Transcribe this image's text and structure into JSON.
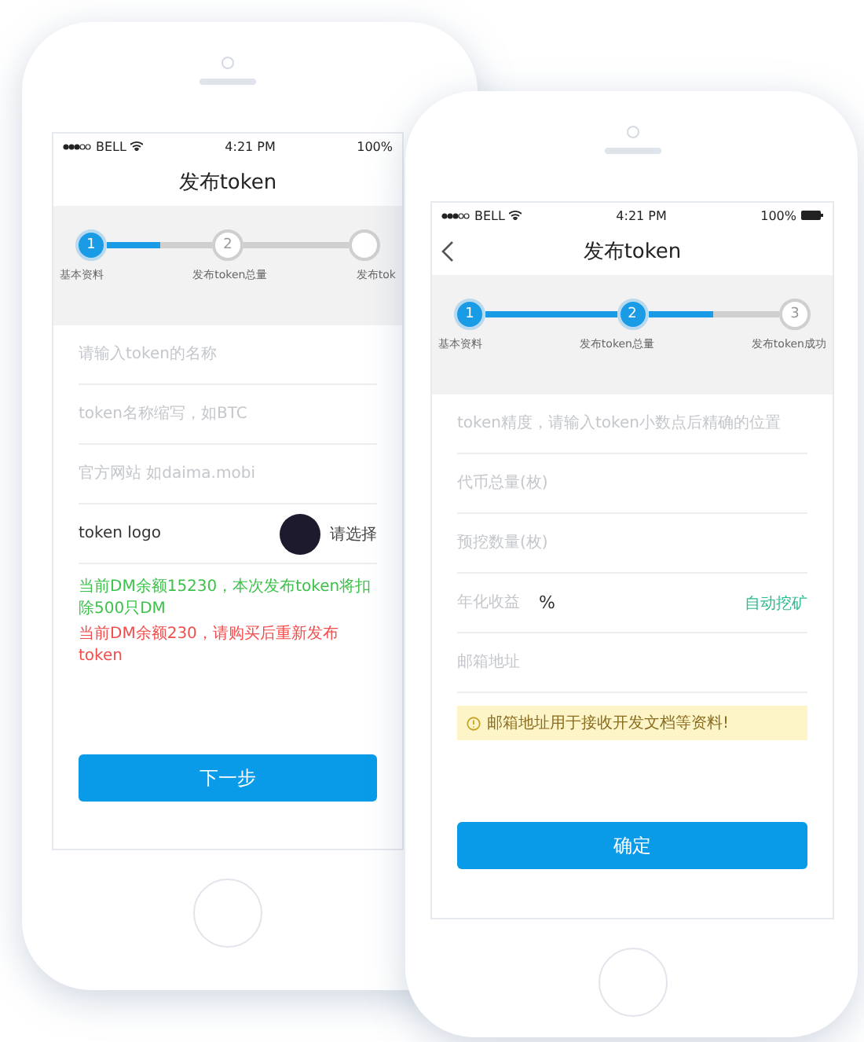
{
  "phones": [
    {
      "status": {
        "carrier": "BELL",
        "time": "4:21 PM",
        "battery": "100%"
      },
      "title": "发布token",
      "back": false,
      "connectors": [
        {
          "level": 0.5
        }
      ],
      "steps": [
        {
          "number": "1",
          "label": "基本资料",
          "done": true
        },
        {
          "number": "2",
          "label": "发布token总量",
          "done": false
        },
        {
          "label": "发布tok",
          "done": false
        }
      ],
      "fields": [
        {
          "kind": "input",
          "placeholder": "请输入token的名称"
        },
        {
          "kind": "input",
          "placeholder": "token名称缩写，如BTC"
        },
        {
          "kind": "input",
          "placeholder": "官方网站 如daima.mobi"
        },
        {
          "kind": "logo",
          "label": "token logo",
          "action": "请选择"
        }
      ],
      "messages": [
        {
          "kind": "message",
          "text": "当前DM余额15230，本次发布token将扣除500只DM",
          "color": "#3cc24a"
        },
        {
          "kind": "message",
          "text": "当前DM余额230，请购买后重新发布token",
          "color": "#f24d4d"
        }
      ],
      "button": "下一步"
    },
    {
      "status": {
        "carrier": "BELL",
        "time": "4:21 PM",
        "battery": "100%"
      },
      "title": "发布token",
      "back": true,
      "connectors": [
        {
          "level": 1
        },
        {
          "level": 0.5
        }
      ],
      "steps": [
        {
          "number": "1",
          "label": "基本资料",
          "done": true
        },
        {
          "number": "2",
          "label": "发布token总量",
          "done": true
        },
        {
          "number": "3",
          "label": "发布token成功",
          "done": false
        }
      ],
      "fields": [
        {
          "kind": "input",
          "placeholder": "token精度，请输入token小数点后精确的位置"
        },
        {
          "kind": "input",
          "placeholder": "代币总量(枚)"
        },
        {
          "kind": "input",
          "placeholder": "预挖数量(枚)"
        },
        {
          "kind": "suffix",
          "placeholder": "年化收益",
          "unit": "%",
          "action": "自动挖矿"
        },
        {
          "kind": "input",
          "placeholder": "邮箱地址"
        }
      ],
      "messages": [
        {
          "kind": "warning",
          "text": "邮箱地址用于接收开发文档等资料!"
        }
      ],
      "button": "确定"
    }
  ]
}
